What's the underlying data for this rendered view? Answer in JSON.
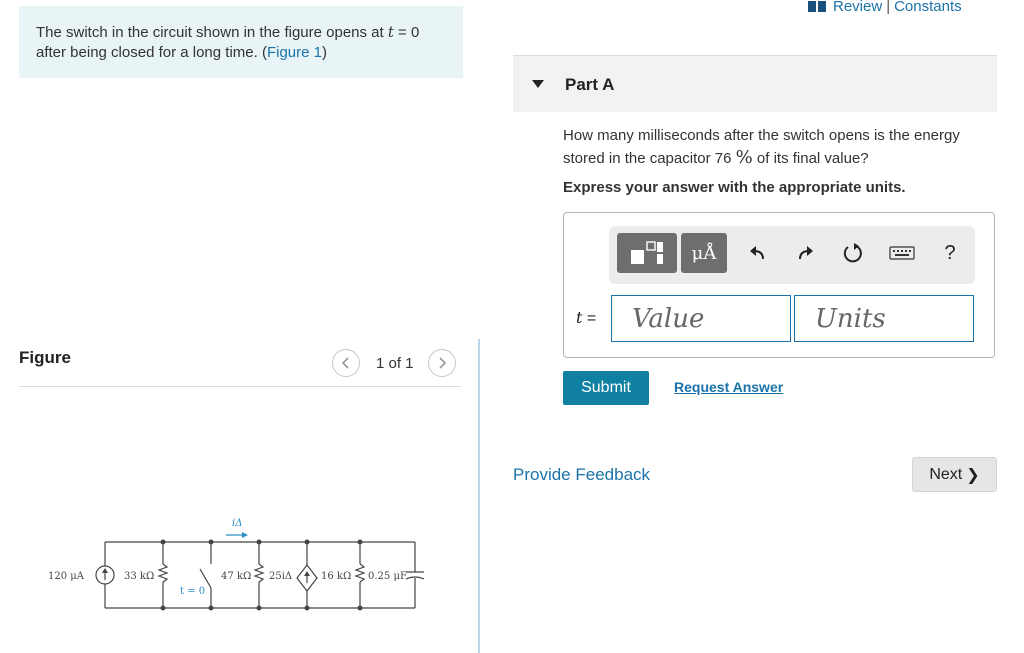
{
  "problem": {
    "text_before": "The switch in the circuit shown in the figure opens at ",
    "var_t": "t",
    "eq_zero": " = 0",
    "text_after": " after being closed for a long time. (",
    "figure_link": "Figure 1",
    "close_paren": ")"
  },
  "figure": {
    "label": "Figure",
    "pager_text": "1 of 1",
    "prev_icon": "chevron-left-icon",
    "next_icon": "chevron-right-icon",
    "circuit": {
      "source_current": "120 μA",
      "r1": "33 kΩ",
      "switch_label": "t = 0",
      "current_label": "iΔ",
      "r2": "47 kΩ",
      "dependent_source": "25iΔ",
      "r3": "16 kΩ",
      "capacitor": "0.25 μF"
    }
  },
  "header": {
    "review_icon": "book-icon",
    "review": "Review",
    "separator": "|",
    "constants": "Constants"
  },
  "part": {
    "caret_icon": "caret-down-icon",
    "title": "Part A",
    "question_before": "How many milliseconds after the switch opens is the energy stored in the capacitor 76 ",
    "percent": "%",
    "question_after": " of its final value?",
    "instruction": "Express your answer with the appropriate units."
  },
  "toolbar": {
    "templates_icon": "templates-icon",
    "units_label": "μÅ",
    "undo_icon": "undo-icon",
    "redo_icon": "redo-icon",
    "reset_icon": "reset-icon",
    "keyboard_icon": "keyboard-icon",
    "help_label": "?"
  },
  "answer": {
    "var_label": "t =",
    "value_placeholder": "Value",
    "units_placeholder": "Units"
  },
  "actions": {
    "submit": "Submit",
    "request_answer": "Request Answer",
    "provide_feedback": "Provide Feedback",
    "next": "Next",
    "next_chevron": "❯"
  },
  "colors": {
    "accent": "#0f7fa2",
    "link": "#1a73a8",
    "problem_bg": "#e8f4f6",
    "part_header_bg": "#f2f2f2"
  }
}
